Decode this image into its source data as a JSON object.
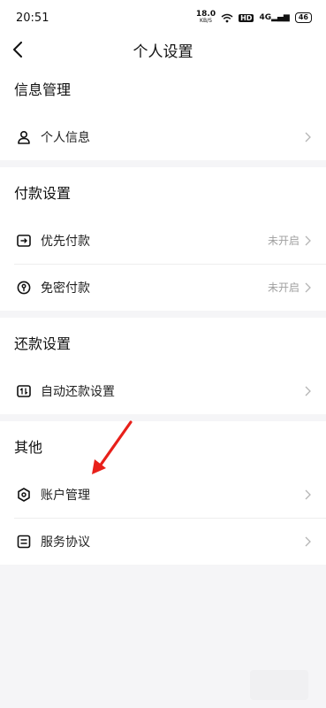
{
  "statusbar": {
    "time": "20:51",
    "speed": "18.0",
    "speed_unit": "KB/S",
    "hd": "HD",
    "signal": "4G",
    "battery": "46"
  },
  "nav": {
    "title": "个人设置"
  },
  "sections": [
    {
      "title": "信息管理",
      "items": [
        {
          "label": "个人信息",
          "value": ""
        }
      ]
    },
    {
      "title": "付款设置",
      "items": [
        {
          "label": "优先付款",
          "value": "未开启"
        },
        {
          "label": "免密付款",
          "value": "未开启"
        }
      ]
    },
    {
      "title": "还款设置",
      "items": [
        {
          "label": "自动还款设置",
          "value": ""
        }
      ]
    },
    {
      "title": "其他",
      "items": [
        {
          "label": "账户管理",
          "value": ""
        },
        {
          "label": "服务协议",
          "value": ""
        }
      ]
    }
  ],
  "colors": {
    "accent_arrow": "#e8201a",
    "background": "#f5f5f7"
  }
}
